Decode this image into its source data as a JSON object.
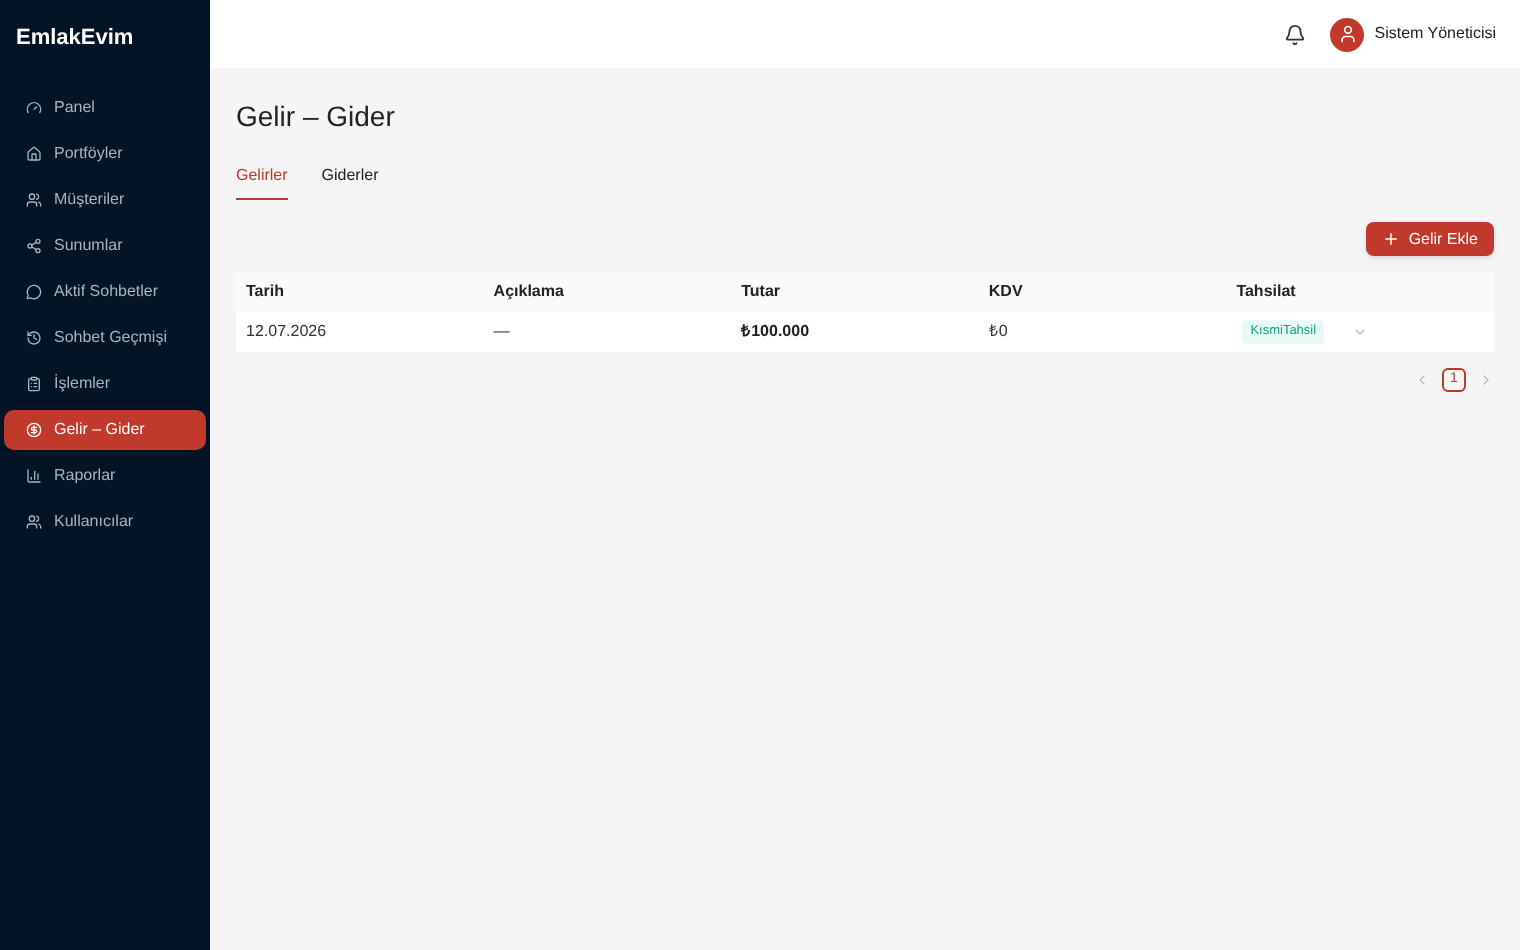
{
  "brand": "EmlakEvim",
  "sidebar": {
    "items": [
      {
        "label": "Panel",
        "selected": false
      },
      {
        "label": "Portföyler",
        "selected": false
      },
      {
        "label": "Müşteriler",
        "selected": false
      },
      {
        "label": "Sunumlar",
        "selected": false
      },
      {
        "label": "Aktif Sohbetler",
        "selected": false
      },
      {
        "label": "Sohbet Geçmişi",
        "selected": false
      },
      {
        "label": "İşlemler",
        "selected": false
      },
      {
        "label": "Gelir – Gider",
        "selected": true
      },
      {
        "label": "Raporlar",
        "selected": false
      },
      {
        "label": "Kullanıcılar",
        "selected": false
      }
    ]
  },
  "header": {
    "user": "Sistem Yöneticisi"
  },
  "page_title": "Gelir – Gider",
  "tabs": [
    {
      "label": "Gelirler",
      "selected": true
    },
    {
      "label": "Giderler",
      "selected": false
    }
  ],
  "add_button": "Gelir Ekle",
  "table": {
    "columns": [
      "Tarih",
      "Açıklama",
      "Tutar",
      "KDV",
      "Tahsilat"
    ],
    "rows": [
      {
        "date": "12.07.2026",
        "description": "—",
        "amount": "₺100.000",
        "vat": "₺0",
        "status": "KısmiTahsil"
      }
    ]
  },
  "pagination": {
    "pages": [
      {
        "label": "1",
        "selected": true
      }
    ]
  }
}
